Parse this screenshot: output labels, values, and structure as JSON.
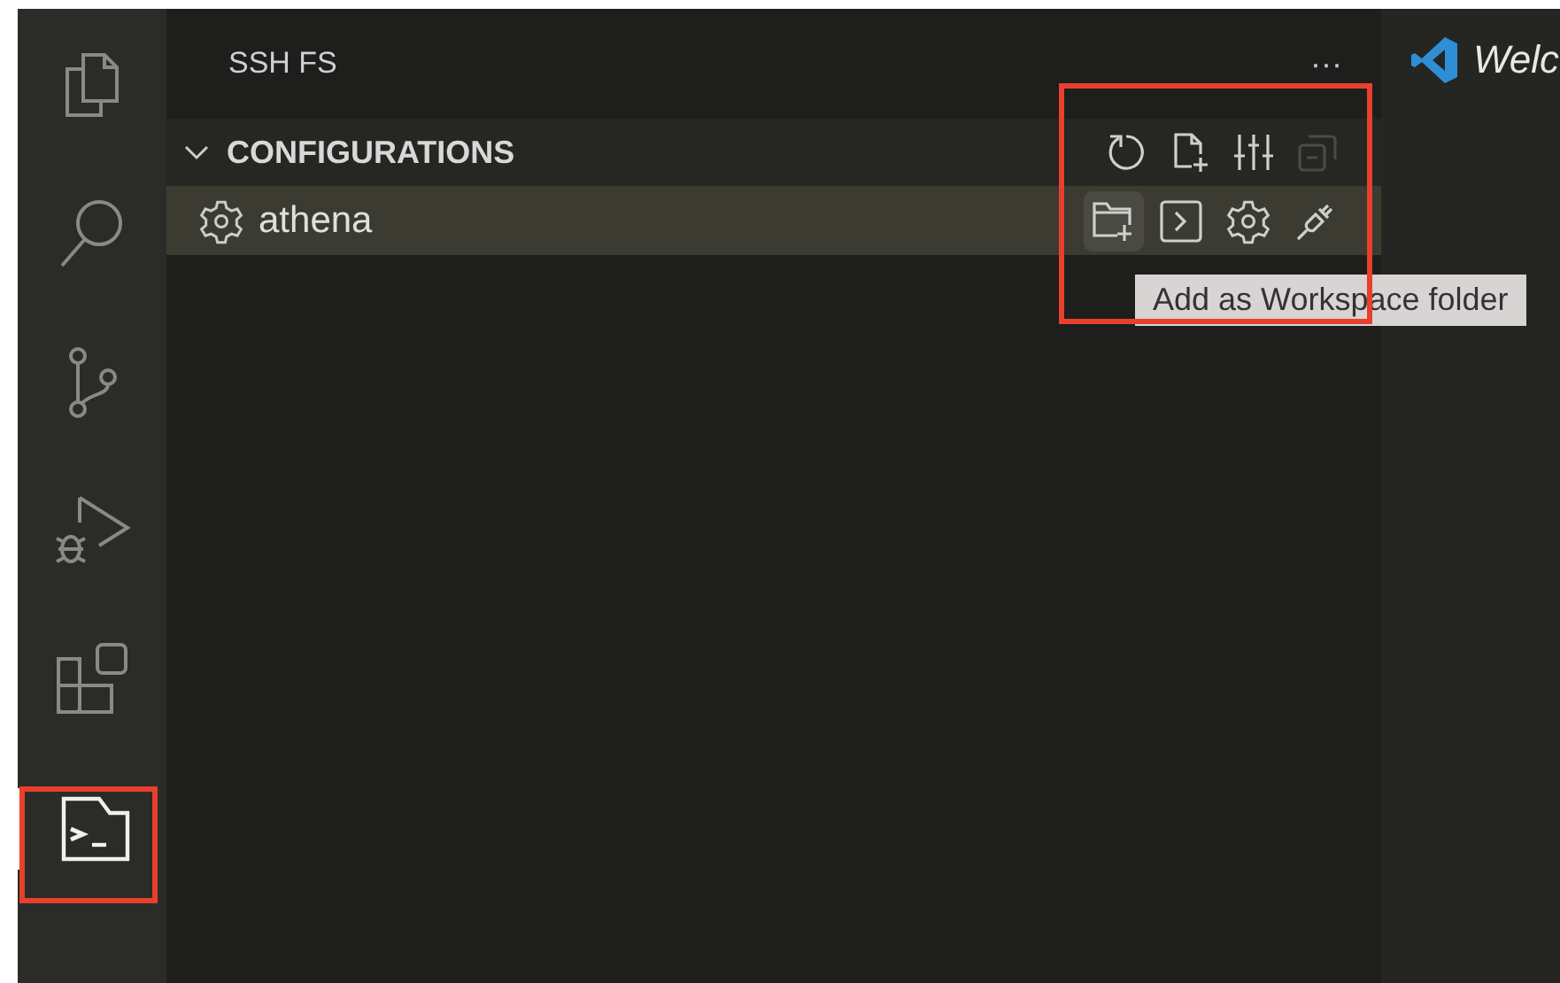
{
  "activity_bar": [
    {
      "kind": "explorer",
      "selected": false
    },
    {
      "kind": "search",
      "selected": false
    },
    {
      "kind": "source-control",
      "selected": false
    },
    {
      "kind": "run-debug",
      "selected": false
    },
    {
      "kind": "extensions",
      "selected": false
    },
    {
      "kind": "ssh-fs",
      "selected": true
    }
  ],
  "sidebar": {
    "title": "SSH FS",
    "more": "···",
    "section": {
      "title": "CONFIGURATIONS",
      "expanded": true,
      "actions": [
        {
          "kind": "refresh",
          "disabled": false
        },
        {
          "kind": "new-file",
          "disabled": false
        },
        {
          "kind": "sliders",
          "disabled": false
        },
        {
          "kind": "collapse-all",
          "disabled": true
        }
      ],
      "items": [
        {
          "label": "athena",
          "selected": true,
          "actions": [
            {
              "kind": "add-folder",
              "hovered": true
            },
            {
              "kind": "terminal",
              "hovered": false
            },
            {
              "kind": "settings",
              "hovered": false
            },
            {
              "kind": "plug",
              "hovered": false
            }
          ]
        }
      ]
    }
  },
  "tooltip": "Add as Workspace folder",
  "editor": {
    "tab": "Welc"
  }
}
